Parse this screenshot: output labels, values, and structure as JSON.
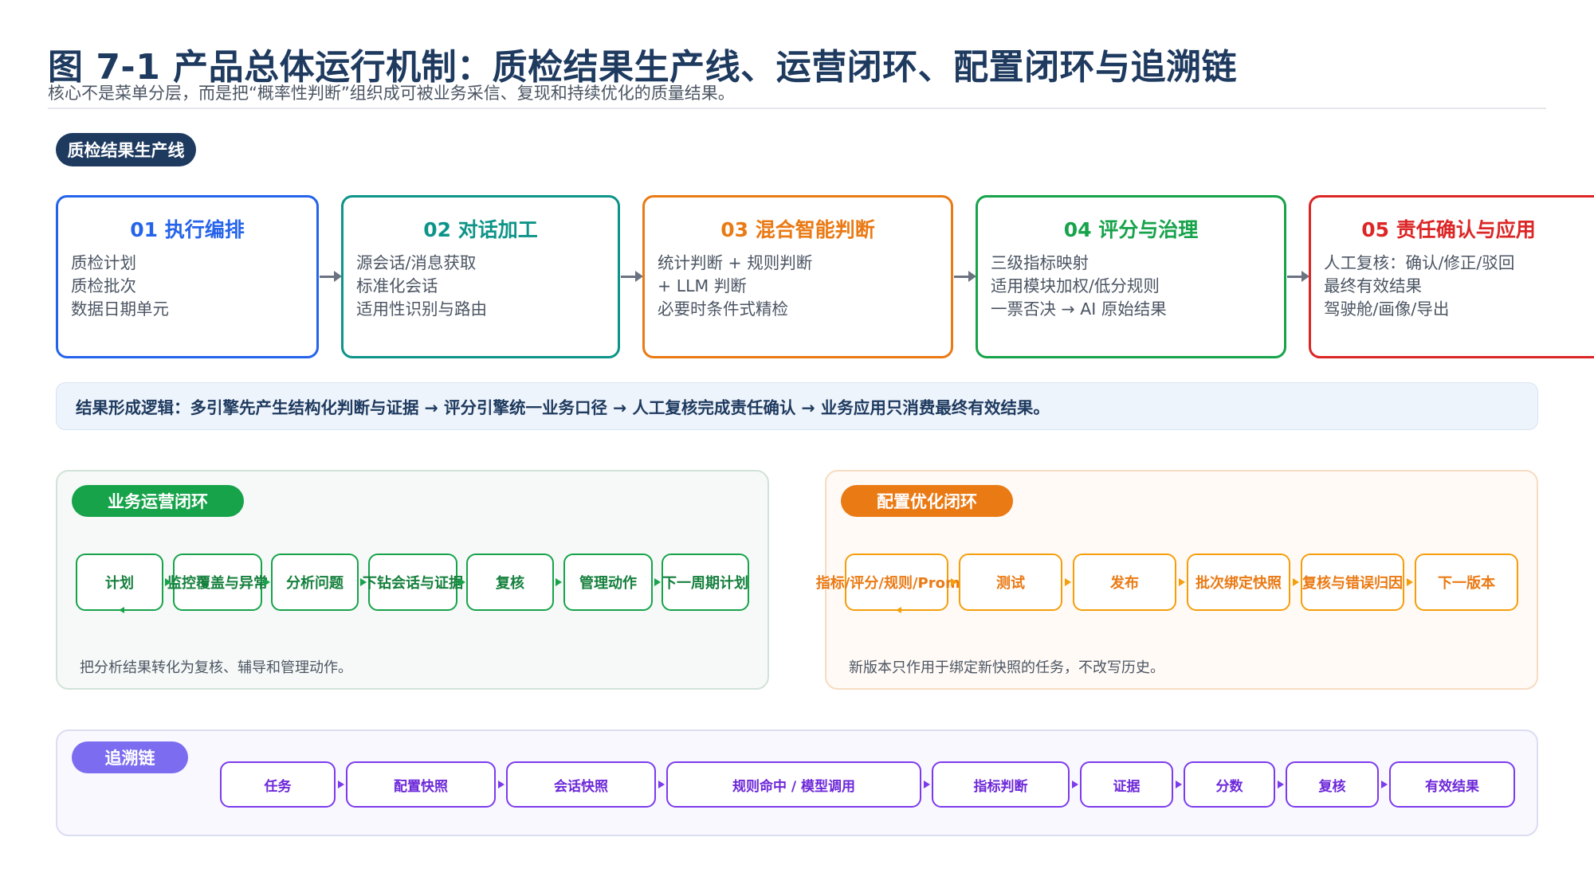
{
  "header": {
    "title": "图 7-1  产品总体运行机制：质检结果生产线、运营闭环、配置闭环与追溯链",
    "subtitle": "核心不是菜单分层，而是把“概率性判断”组织成可被业务采信、复现和持续优化的质量结果。"
  },
  "pipeline": {
    "label": "质检结果生产线",
    "stages": [
      {
        "title": "01 执行编排",
        "color": "#2563eb",
        "lines": [
          "质检计划",
          "质检批次",
          "数据日期单元"
        ]
      },
      {
        "title": "02 对话加工",
        "color": "#0d9488",
        "lines": [
          "源会话/消息获取",
          "标准化会话",
          "适用性识别与路由"
        ]
      },
      {
        "title": "03 混合智能判断",
        "color": "#ea7a14",
        "lines": [
          "统计判断 + 规则判断",
          "+ LLM 判断",
          "必要时条件式精检"
        ]
      },
      {
        "title": "04 评分与治理",
        "color": "#16a34a",
        "lines": [
          "三级指标映射",
          "适用模块加权/低分规则",
          "一票否决 → AI 原始结果"
        ]
      },
      {
        "title": "05 责任确认与应用",
        "color": "#dc2626",
        "lines": [
          "人工复核：确认/修正/驳回",
          "最终有效结果",
          "驾驶舱/画像/导出"
        ]
      }
    ]
  },
  "logic_banner": "结果形成逻辑：多引擎先产生结构化判断与证据 → 评分引擎统一业务口径 → 人工复核完成责任确认 → 业务应用只消费最终有效结果。",
  "ops_loop": {
    "label": "业务运营闭环",
    "nodes": [
      "计划",
      "监控覆盖与异常",
      "分析问题",
      "下钻会话与证据",
      "复核",
      "管理动作",
      "下一周期计划"
    ],
    "note": "把分析结果转化为复核、辅导和管理动作。",
    "color": "#16a34a"
  },
  "config_loop": {
    "label": "配置优化闭环",
    "nodes": [
      "指标/评分/规则/Prompt",
      "测试",
      "发布",
      "批次绑定快照",
      "复核与错误归因",
      "下一版本"
    ],
    "note": "新版本只作用于绑定新快照的任务，不改写历史。",
    "color": "#f59e0b"
  },
  "trace": {
    "label": "追溯链",
    "nodes": [
      "任务",
      "配置快照",
      "会话快照",
      "规则命中 / 模型调用",
      "指标判断",
      "证据",
      "分数",
      "复核",
      "有效结果"
    ],
    "color": "#7c3aed"
  }
}
